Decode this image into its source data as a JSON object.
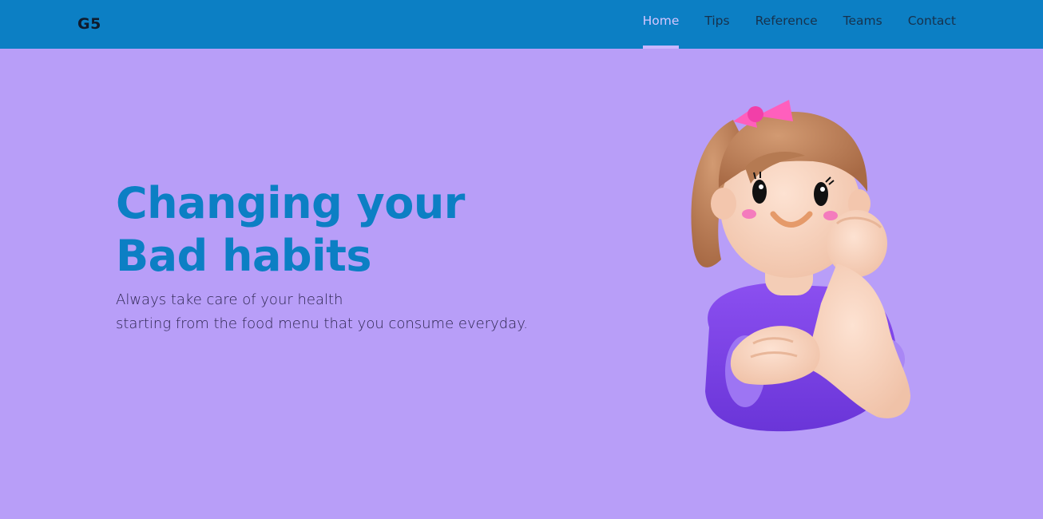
{
  "brand": {
    "logo": "G5"
  },
  "nav": {
    "items": [
      {
        "label": "Home",
        "active": true
      },
      {
        "label": "Tips"
      },
      {
        "label": "Reference"
      },
      {
        "label": "Teams"
      },
      {
        "label": "Contact"
      }
    ]
  },
  "hero": {
    "title_line1": "Changing your",
    "title_line2": "Bad habits",
    "subtitle_line1": "Always take care of your health",
    "subtitle_line2": "starting from the food menu that you consume everyday."
  },
  "colors": {
    "header": "#0c7fc4",
    "background": "#b89ef8",
    "title": "#0c7fc4",
    "nav_active": "#d5c6ff"
  }
}
